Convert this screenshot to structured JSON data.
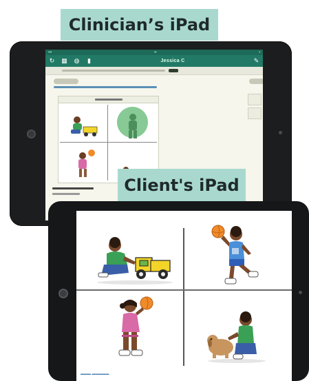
{
  "labels": {
    "clinician_ipad": "Clinician’s iPad",
    "client_ipad": "Client's iPad"
  },
  "clinician_app": {
    "nav_title": "Jessica C",
    "nav_icons": [
      "refresh-icon",
      "grid-icon",
      "globe-icon",
      "trash-icon",
      "pencil-icon"
    ],
    "accent_color": "#227a66",
    "highlighted_cell": "top-right"
  },
  "client_screen": {
    "cells": [
      {
        "position": "top-left",
        "depicts": "boy-pushing-toy-truck"
      },
      {
        "position": "top-right",
        "depicts": "boy-throwing-ball"
      },
      {
        "position": "bottom-left",
        "depicts": "girl-holding-ball"
      },
      {
        "position": "bottom-right",
        "depicts": "boy-petting-dog"
      }
    ]
  }
}
